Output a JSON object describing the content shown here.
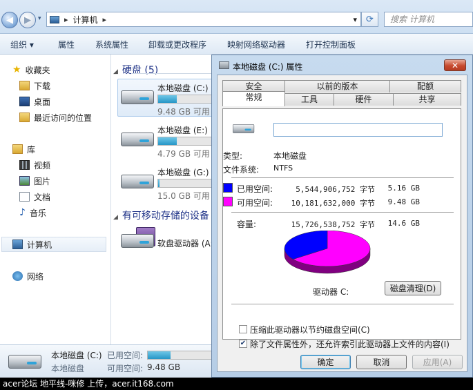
{
  "address_bar": {
    "back_label": "◀",
    "forward_label": "▶",
    "path_root": "▸",
    "path_item": "计算机",
    "path_sep": "▸",
    "dropdown": "▾",
    "refresh": "⟳",
    "search_placeholder": "搜索 计算机"
  },
  "toolbar": {
    "organize": "组织 ▾",
    "properties": "属性",
    "system_properties": "系统属性",
    "uninstall": "卸载或更改程序",
    "map_drive": "映射网络驱动器",
    "control_panel": "打开控制面板"
  },
  "nav": {
    "favorites": "收藏夹",
    "downloads": "下载",
    "desktop": "桌面",
    "recent": "最近访问的位置",
    "libraries": "库",
    "videos": "视频",
    "pictures": "图片",
    "documents": "文档",
    "music": "音乐",
    "computer": "计算机",
    "network": "网络"
  },
  "content": {
    "hdd_group": "硬盘 (5)",
    "removable_group": "有可移动存储的设备",
    "drives": [
      {
        "name": "本地磁盘 (C:)",
        "free": "9.48 GB 可用",
        "used_fraction": 0.35
      },
      {
        "name": "本地磁盘 (E:)",
        "free": "4.79 GB 可用",
        "used_fraction": 0.35
      },
      {
        "name": "本地磁盘 (G:)",
        "free": "15.0 GB 可用",
        "used_fraction": 0.03
      }
    ],
    "floppy": "软盘驱动器 (A:)"
  },
  "details": {
    "name": "本地磁盘 (C:)",
    "type": "本地磁盘",
    "used_label": "已用空间:",
    "free_label": "可用空间:",
    "free_value": "9.48 GB",
    "used_fraction": 0.35
  },
  "dialog": {
    "title": "本地磁盘 (C:) 属性",
    "close": "✕",
    "tabs_row1": [
      "安全",
      "以前的版本",
      "配额"
    ],
    "tabs_row2": [
      "常规",
      "工具",
      "硬件",
      "共享"
    ],
    "name_value": "",
    "type_label": "类型:",
    "type_value": "本地磁盘",
    "fs_label": "文件系统:",
    "fs_value": "NTFS",
    "used_label": "已用空间:",
    "used_bytes": "5,544,906,752 字节",
    "used_gb": "5.16 GB",
    "free_label": "可用空间:",
    "free_bytes": "10,181,632,000 字节",
    "free_gb": "9.48 GB",
    "capacity_label": "容量:",
    "capacity_bytes": "15,726,538,752 字节",
    "capacity_gb": "14.6 GB",
    "drive_label": "驱动器 C:",
    "cleanup": "磁盘清理(D)",
    "compress": "压缩此驱动器以节约磁盘空间(C)",
    "index": "除了文件属性外，还允许索引此驱动器上文件的内容(I)",
    "compress_checked": false,
    "index_checked": true,
    "ok": "确定",
    "cancel": "取消",
    "apply": "应用(A)",
    "used_color": "#0000ff",
    "free_color": "#ff00ff"
  },
  "caption": "acer论坛 地平线-咪修 上传，acer.it168.com"
}
